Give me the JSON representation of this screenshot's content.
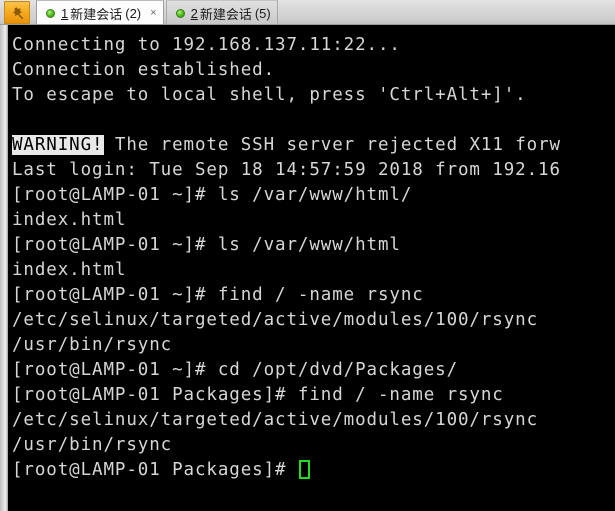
{
  "window": {
    "app_icon_name": "securecrt-app-icon",
    "background_color": "#000000",
    "tabbar_color": "#d6d6d6"
  },
  "tabbar": {
    "tabs": [
      {
        "index_label": "1",
        "title": "新建会话",
        "count_label": "(2)",
        "close_label": "×",
        "status": "connected",
        "active": true
      },
      {
        "index_label": "2",
        "title": "新建会话",
        "count_label": "(5)",
        "close_label": "",
        "status": "connected",
        "active": false
      }
    ]
  },
  "terminal": {
    "foreground_color": "#d6d6d6",
    "background_color": "#000000",
    "cursor_color": "#22dd22",
    "lines": [
      {
        "id": "l01",
        "text": "Connecting to 192.168.137.11:22..."
      },
      {
        "id": "l02",
        "text": "Connection established."
      },
      {
        "id": "l03",
        "text": "To escape to local shell, press 'Ctrl+Alt+]'."
      },
      {
        "id": "l04",
        "text": ""
      },
      {
        "id": "l05",
        "inverse_prefix": "WARNING!",
        "text": " The remote SSH server rejected X11 forw"
      },
      {
        "id": "l06",
        "text": "Last login: Tue Sep 18 14:57:59 2018 from 192.16"
      },
      {
        "id": "l07",
        "text": "[root@LAMP-01 ~]# ls /var/www/html/"
      },
      {
        "id": "l08",
        "text": "index.html"
      },
      {
        "id": "l09",
        "text": "[root@LAMP-01 ~]# ls /var/www/html"
      },
      {
        "id": "l10",
        "text": "index.html"
      },
      {
        "id": "l11",
        "text": "[root@LAMP-01 ~]# find / -name rsync"
      },
      {
        "id": "l12",
        "text": "/etc/selinux/targeted/active/modules/100/rsync"
      },
      {
        "id": "l13",
        "text": "/usr/bin/rsync"
      },
      {
        "id": "l14",
        "text": "[root@LAMP-01 ~]# cd /opt/dvd/Packages/"
      },
      {
        "id": "l15",
        "text": "[root@LAMP-01 Packages]# find / -name rsync"
      },
      {
        "id": "l16",
        "text": "/etc/selinux/targeted/active/modules/100/rsync"
      },
      {
        "id": "l17",
        "text": "/usr/bin/rsync"
      },
      {
        "id": "l18",
        "text": "[root@LAMP-01 Packages]# ",
        "cursor": true
      }
    ]
  }
}
